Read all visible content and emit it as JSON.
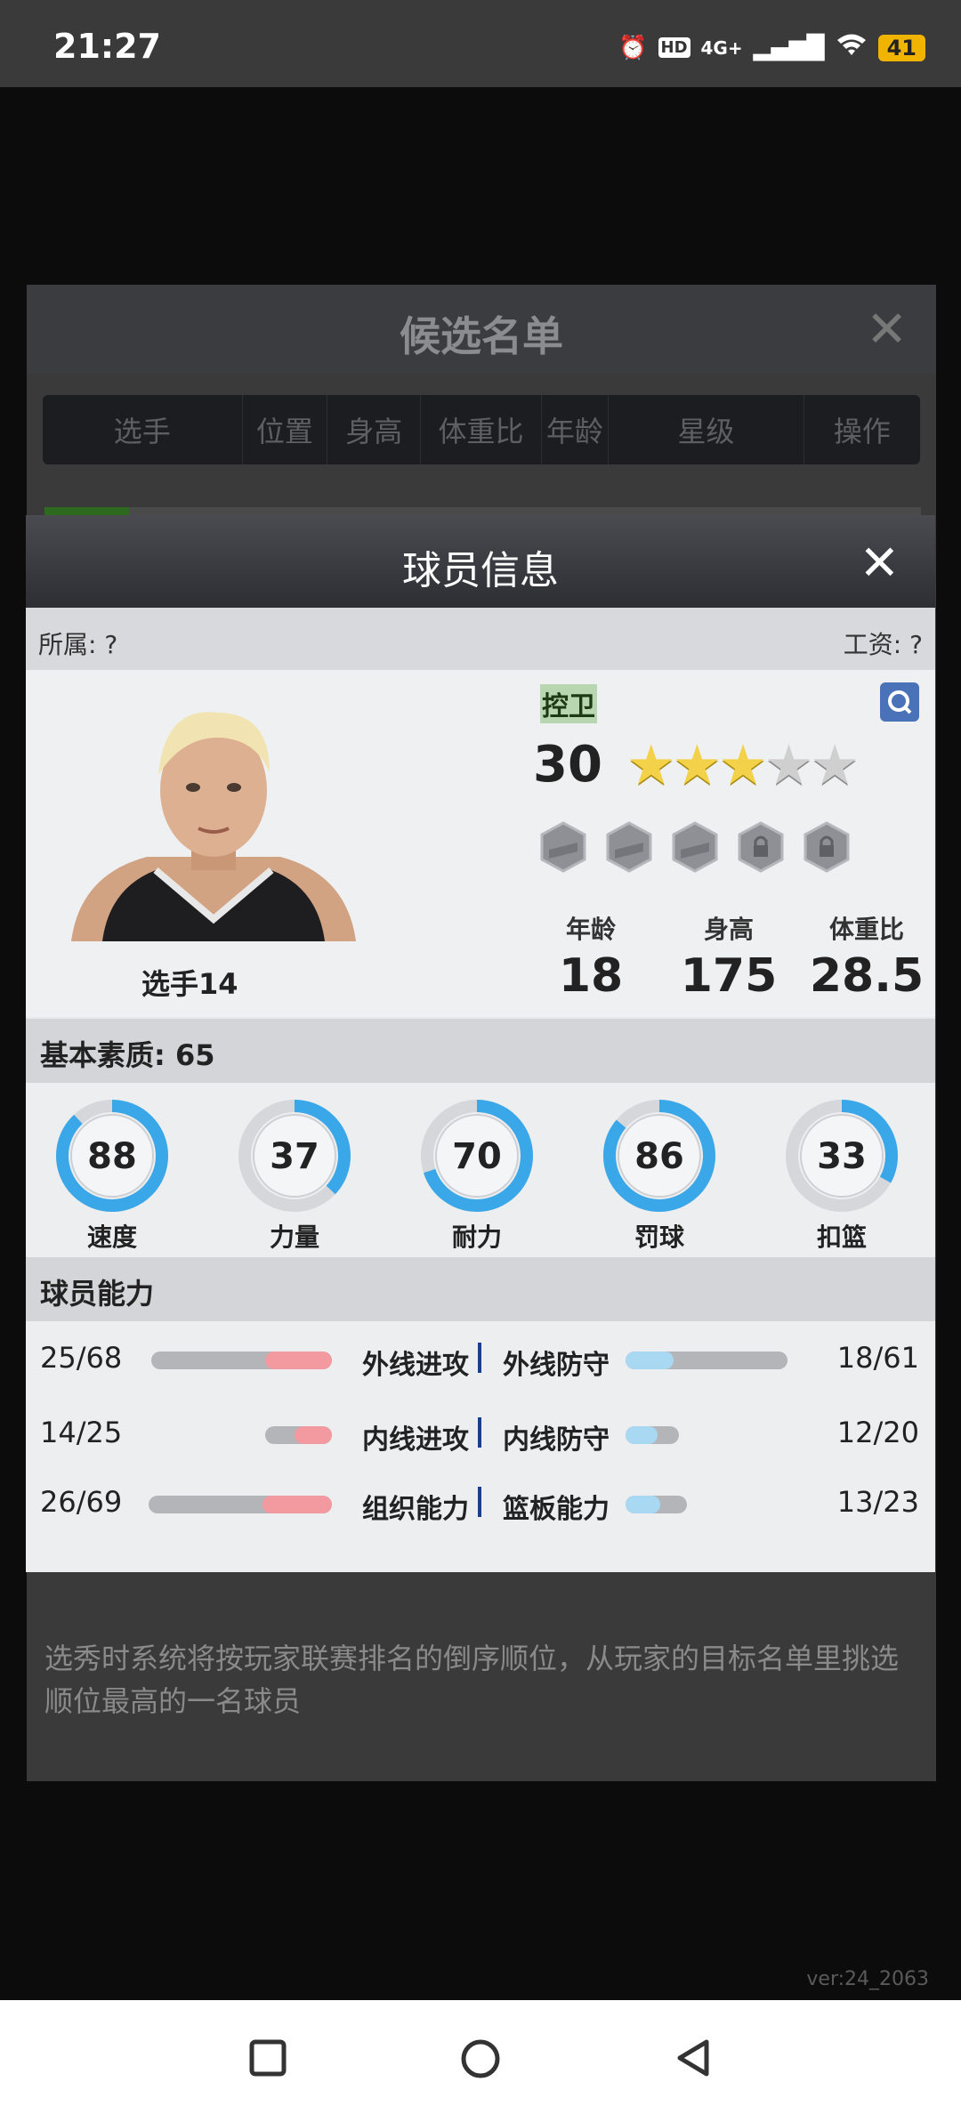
{
  "status_bar": {
    "time": "21:27",
    "network": "4G+",
    "battery": "41"
  },
  "background": {
    "dialog_title": "候选名单",
    "close_label": "✕",
    "columns": [
      "选手",
      "位置",
      "身高",
      "体重比",
      "年龄",
      "星级",
      "操作"
    ],
    "note": "选秀时系统将按玩家联赛排名的倒序顺位，从玩家的目标名单里挑选顺位最高的一名球员",
    "version": "ver:24_2063"
  },
  "modal": {
    "title": "球员信息",
    "close_label": "✕",
    "affiliation": "所属: ?",
    "salary": "工资: ?",
    "player": {
      "name": "选手14",
      "position": "控卫",
      "overall": "30",
      "stars_filled": 3,
      "stars_total": 5,
      "badges": [
        {
          "locked": false
        },
        {
          "locked": false
        },
        {
          "locked": false
        },
        {
          "locked": true
        },
        {
          "locked": true
        }
      ],
      "bio": [
        {
          "label": "年龄",
          "value": "18"
        },
        {
          "label": "身高",
          "value": "175"
        },
        {
          "label": "体重比",
          "value": "28.5"
        }
      ]
    },
    "basic_title": "基本素质: 65",
    "basic_stats": [
      {
        "label": "速度",
        "value": 88
      },
      {
        "label": "力量",
        "value": 37
      },
      {
        "label": "耐力",
        "value": 70
      },
      {
        "label": "罚球",
        "value": 86
      },
      {
        "label": "扣篮",
        "value": 33
      }
    ],
    "ability_title": "球员能力",
    "abilities": [
      {
        "left_name": "外线进攻",
        "left_value": "25/68",
        "right_name": "外线防守",
        "right_value": "18/61"
      },
      {
        "left_name": "内线进攻",
        "left_value": "14/25",
        "right_name": "内线防守",
        "right_value": "12/20"
      },
      {
        "left_name": "组织能力",
        "left_value": "26/69",
        "right_name": "篮板能力",
        "right_value": "13/23"
      }
    ]
  },
  "colors": {
    "gauge": "#3aa7e8",
    "attack": "#f29aa0",
    "defense": "#a9d8f2",
    "position_bg": "#b8d6b0"
  }
}
